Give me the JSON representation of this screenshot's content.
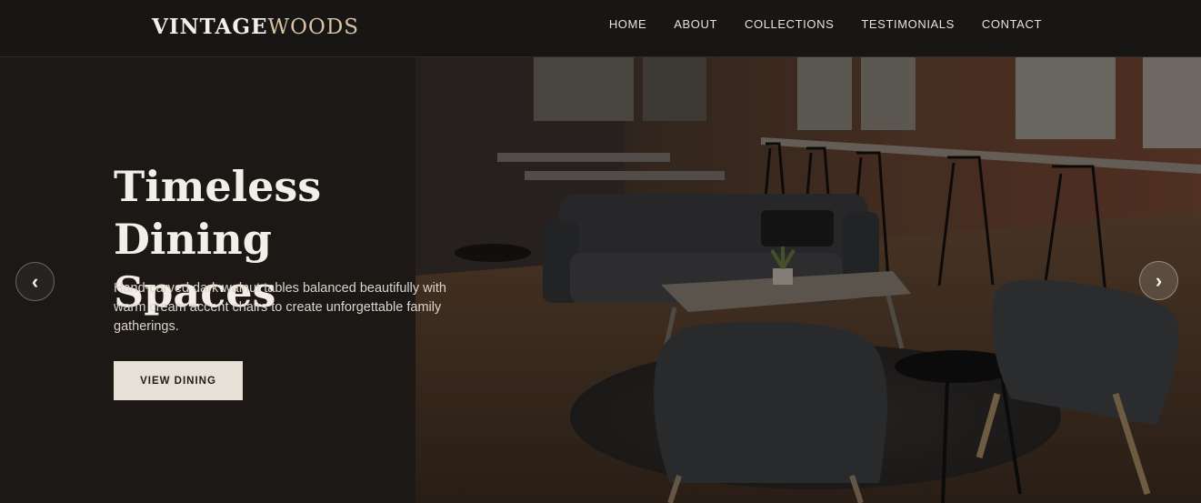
{
  "brand": {
    "part1": "VINTAGE",
    "part2": "WOODS"
  },
  "nav": {
    "items": [
      "HOME",
      "ABOUT",
      "COLLECTIONS",
      "TESTIMONIALS",
      "CONTACT"
    ]
  },
  "hero": {
    "title_line1": "Timeless Dining",
    "title_line2": "Spaces",
    "description": "Hand-carved dark walnut tables balanced beautifully with warm cream accent chairs to create unforgettable family gatherings.",
    "button_label": "VIEW DINING",
    "prev_arrow": "‹",
    "next_arrow": "›"
  },
  "colors": {
    "background": "#1b1816",
    "button": "#e6e0d7",
    "accent": "#d9c4a6"
  }
}
